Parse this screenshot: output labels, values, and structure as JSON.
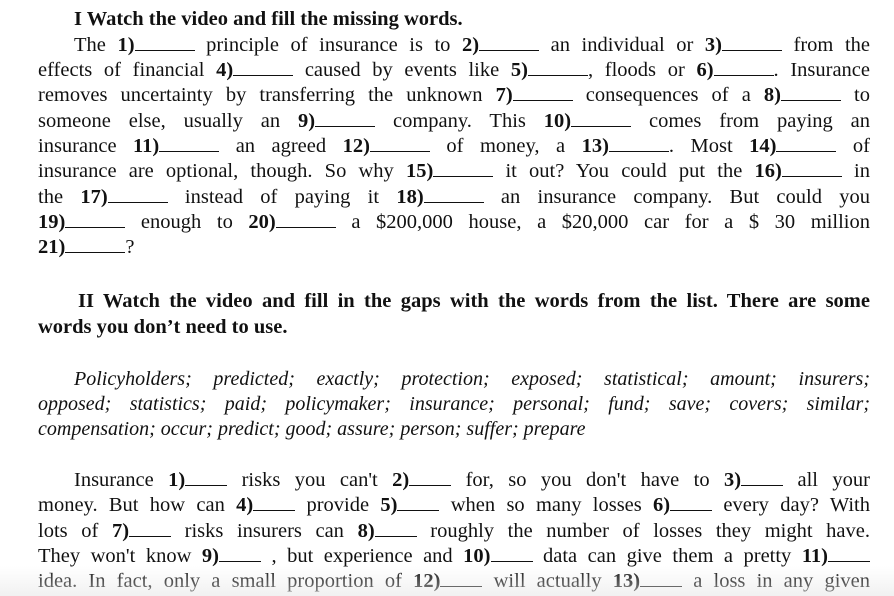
{
  "section1": {
    "heading": "I Watch the video  and fill the missing words.",
    "lines": [
      [
        "The ",
        "1)",
        " principle of insurance is to ",
        "2)",
        " an individual or ",
        "3)",
        " from the"
      ],
      [
        "effects of financial ",
        "4)",
        " caused by events like ",
        "5)",
        ", floods or ",
        "6)",
        ". Insurance"
      ],
      [
        "removes uncertainty by transferring the unknown ",
        "7)",
        " consequences of a ",
        "8)",
        " to"
      ],
      [
        "someone else, usually an ",
        "9)",
        " company. This ",
        "10)",
        " comes from paying an"
      ],
      [
        "insurance ",
        "11)",
        " an agreed ",
        "12)",
        " of money, a ",
        "13)",
        ". Most ",
        "14)",
        " of"
      ],
      [
        "insurance are optional, though. So why ",
        "15)",
        " it out? You could put the ",
        "16)",
        " in"
      ],
      [
        "the ",
        "17)",
        " instead of paying it ",
        "18)",
        " an insurance company.  But could you"
      ],
      [
        "",
        "19)",
        " enough to ",
        "20)",
        " a $200,000 house, a $20,000 car for a $ 30 million"
      ],
      [
        "",
        "21)",
        "?"
      ]
    ]
  },
  "section2": {
    "heading_line1": "II Watch the video  and fill in the gaps with the words from the list. There are some",
    "heading_line2": "words you don’t need to use.",
    "word_list_lines": [
      "Policyholders; predicted; exactly; protection; exposed; statistical; amount; insurers;",
      "opposed; statistics; paid; policymaker; insurance; personal; fund; save; covers; similar;",
      "compensation; occur; predict; good; assure; person; suffer; prepare"
    ],
    "lines": [
      [
        "Insurance ",
        "1)",
        " risks you can't ",
        "2)",
        " for, so you don't have to ",
        "3)",
        " all your"
      ],
      [
        "money. But how can ",
        "4)",
        " provide ",
        "5)",
        " when so many losses ",
        "6)",
        " every day? With"
      ],
      [
        "lots of ",
        "7)",
        " risks insurers can ",
        "8)",
        " roughly the number of losses they might have."
      ],
      [
        "They won't know ",
        "9)",
        " , but experience and ",
        "10)",
        " data can give them a pretty ",
        "11)",
        ""
      ],
      [
        "idea. In fact, only a small proportion of ",
        "12)",
        " will actually ",
        "13)",
        " a loss in any given"
      ]
    ]
  }
}
